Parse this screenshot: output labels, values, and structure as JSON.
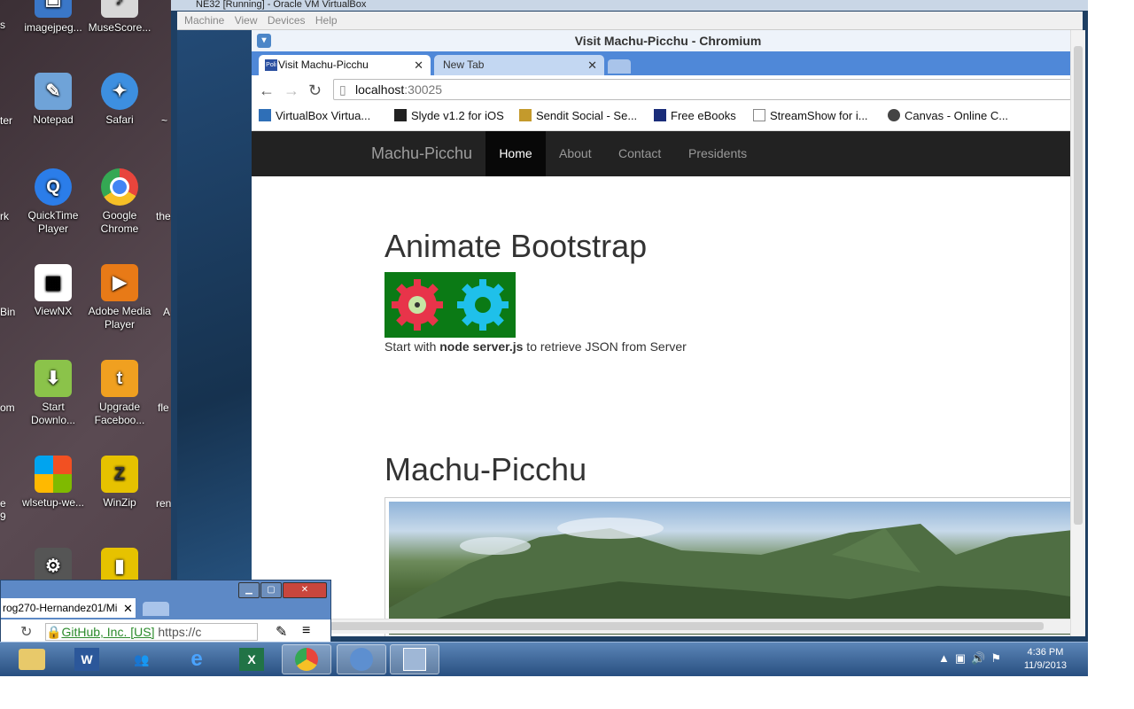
{
  "desktop": {
    "icons": [
      {
        "label": "imagejpeg...",
        "x": "col1",
        "color": "#3a77c8",
        "glyph": "image-icon"
      },
      {
        "label": "MuseScore...",
        "color": "#ddd",
        "glyph": "musescore-icon"
      },
      {
        "label": "Notepad",
        "color": "#6fa3d8",
        "glyph": "notepad-icon"
      },
      {
        "label": "Safari",
        "color": "#3d8fe0",
        "glyph": "compass-icon"
      },
      {
        "label": "QuickTime Player",
        "color": "#2b7de9",
        "glyph": "quicktime-icon"
      },
      {
        "label": "Google Chrome",
        "color": "#e8453c",
        "glyph": "chrome-icon"
      },
      {
        "label": "ViewNX",
        "color": "#ffffff",
        "glyph": "grid-icon"
      },
      {
        "label": "Adobe Media Player",
        "color": "#e87a17",
        "glyph": "play-icon"
      },
      {
        "label": "Start Downlo...",
        "color": "#8bc34a",
        "glyph": "download-icon"
      },
      {
        "label": "Upgrade Faceboo...",
        "color": "#f0a020",
        "glyph": "t-icon"
      },
      {
        "label": "wlsetup-we...",
        "color": "#3b8fdd",
        "glyph": "windows-icon"
      },
      {
        "label": "WinZip",
        "color": "#e6c200",
        "glyph": "zip-icon"
      }
    ],
    "cut_labels": {
      "c1": "s",
      "c2": "ter",
      "c3": "rk",
      "c4": "Bin",
      "c5": "om",
      "c6": "e",
      "c7": "9",
      "r1": "~",
      "r2": "the",
      "r3": "A",
      "r4": "fle",
      "r5": "ren"
    }
  },
  "vm": {
    "title": "NE32 [Running] - Oracle VM VirtualBox",
    "menu": [
      "Machine",
      "View",
      "Devices",
      "Help"
    ]
  },
  "browser": {
    "window_title": "Visit Machu-Picchu - Chromium",
    "tabs": [
      {
        "label": "Visit Machu-Picchu",
        "favicon": "Poli"
      },
      {
        "label": "New Tab"
      }
    ],
    "address": {
      "host": "localhost",
      "port": ":30025"
    },
    "bookmarks": [
      "VirtualBox Virtua...",
      "Slyde v1.2 for iOS",
      "Sendit Social - Se...",
      "Free eBooks",
      "StreamShow for i...",
      "Canvas - Online C..."
    ]
  },
  "page": {
    "brand": "Machu-Picchu",
    "nav": [
      "Home",
      "About",
      "Contact",
      "Presidents"
    ],
    "heading1": "Animate Bootstrap",
    "desc_before": "Start with ",
    "desc_bold": "node server.js",
    "desc_after": " to retrieve JSON from Server",
    "heading2": "Machu-Picchu"
  },
  "github_window": {
    "tab": "rog270-Hernandez01/Mi",
    "address": "GitHub, Inc. [US] https://c",
    "cert_label": "GitHub, Inc. [US]",
    "url_fragment": "https://c"
  },
  "taskbar": {
    "time": "4:36 PM",
    "date": "11/9/2013"
  }
}
